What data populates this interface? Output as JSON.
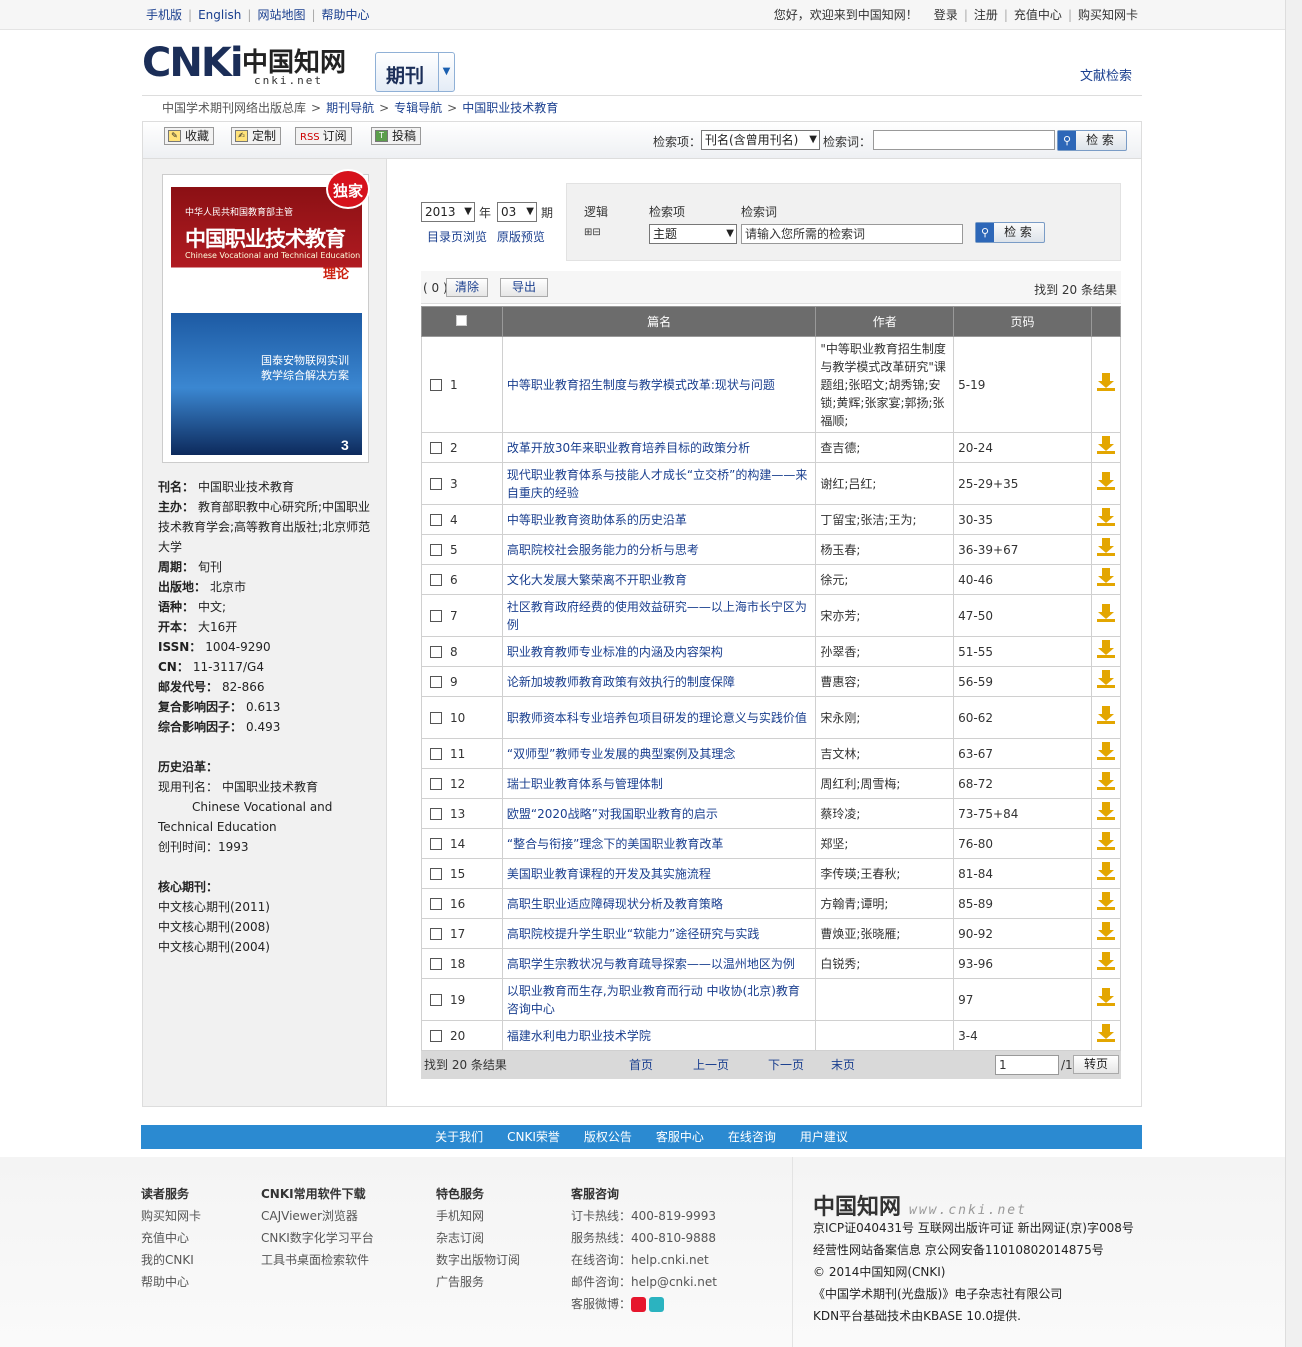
{
  "topbar": {
    "left": [
      "手机版",
      "English",
      "网站地图",
      "帮助中心"
    ],
    "welcome": "您好，欢迎来到中国知网！",
    "right": [
      "登录",
      "注册",
      "充值中心",
      "购买知网卡"
    ]
  },
  "header": {
    "logo_text": "CNKi",
    "logo_cn": "中国知网",
    "logo_domain": "cnki.net",
    "journal_btn": "期刊",
    "wenxian": "文献检索"
  },
  "breadcrumb": [
    "中国学术期刊网络出版总库",
    "期刊导航",
    "专辑导航",
    "中国职业技术教育"
  ],
  "toolbar": {
    "buttons": [
      "收藏",
      "定制",
      "订阅",
      "投稿"
    ],
    "rss": "RSS",
    "search_item_label": "检索项：",
    "search_item_value": "刊名(含曾用刊名)",
    "search_word_label": "检索词：",
    "search_btn": "检 索"
  },
  "cover": {
    "line1": "中华人民共和国教育部主管",
    "title": "中国职业技术教育",
    "subtitle": "Chinese Vocational and Technical Education",
    "section": "理论",
    "badge": "独家",
    "brand": "国泰安物联网实训",
    "brand2": "教学综合解决方案",
    "issue": "3"
  },
  "journal_info": [
    {
      "k": "刊名：",
      "v": "中国职业技术教育"
    },
    {
      "k": "主办：",
      "v": "教育部职教中心研究所;中国职业技术教育学会;高等教育出版社;北京师范大学"
    },
    {
      "k": "周期：",
      "v": "旬刊"
    },
    {
      "k": "出版地：",
      "v": "北京市"
    },
    {
      "k": "语种：",
      "v": "中文;"
    },
    {
      "k": "开本：",
      "v": "大16开"
    },
    {
      "k": "ISSN：",
      "v": "1004-9290"
    },
    {
      "k": "CN：",
      "v": "11-3117/G4"
    },
    {
      "k": "邮发代号：",
      "v": "82-866"
    },
    {
      "k": "复合影响因子：",
      "v": "0.613"
    },
    {
      "k": "综合影响因子：",
      "v": "0.493"
    }
  ],
  "history": {
    "title": "历史沿革：",
    "current_label": "现用刊名：",
    "current": "中国职业技术教育",
    "english": "Chinese Vocational and Technical Education",
    "founded_label": "创刊时间：",
    "founded": "1993"
  },
  "core": {
    "title": "核心期刊：",
    "items": [
      "中文核心期刊(2011)",
      "中文核心期刊(2008)",
      "中文核心期刊(2004)"
    ]
  },
  "issue": {
    "year": "2013",
    "year_unit": "年",
    "no": "03",
    "no_unit": "期",
    "toc": "目录页浏览",
    "preview": "原版预览"
  },
  "adv": {
    "logic": "逻辑",
    "field": "检索项",
    "word": "检索词",
    "field_value": "主题",
    "placeholder": "请输入您所需的检索词",
    "search_btn": "检 索"
  },
  "results": {
    "selected": "( 0 )",
    "clear": "清除",
    "export": "导出",
    "found": "找到 20 条结果"
  },
  "table": {
    "headers": [
      "篇名",
      "作者",
      "页码"
    ],
    "rows": [
      {
        "n": "1",
        "title": "中等职业教育招生制度与教学模式改革:现状与问题",
        "author": "\"中等职业教育招生制度与教学模式改革研究\"课题组;张昭文;胡秀锦;安锁;黄辉;张家宴;郭扬;张福顺;",
        "pages": "5-19"
      },
      {
        "n": "2",
        "title": "改革开放30年来职业教育培养目标的政策分析",
        "author": "查吉德;",
        "pages": "20-24"
      },
      {
        "n": "3",
        "title": "现代职业教育体系与技能人才成长“立交桥”的构建——来自重庆的经验",
        "author": "谢红;吕红;",
        "pages": "25-29+35"
      },
      {
        "n": "4",
        "title": "中等职业教育资助体系的历史沿革",
        "author": "丁留宝;张洁;王为;",
        "pages": "30-35"
      },
      {
        "n": "5",
        "title": "高职院校社会服务能力的分析与思考",
        "author": "杨玉春;",
        "pages": "36-39+67"
      },
      {
        "n": "6",
        "title": "文化大发展大繁荣离不开职业教育",
        "author": "徐元;",
        "pages": "40-46"
      },
      {
        "n": "7",
        "title": "社区教育政府经费的使用效益研究——以上海市长宁区为例",
        "author": "宋亦芳;",
        "pages": "47-50"
      },
      {
        "n": "8",
        "title": "职业教育教师专业标准的内涵及内容架构",
        "author": "孙翠香;",
        "pages": "51-55"
      },
      {
        "n": "9",
        "title": "论新加坡教师教育政策有效执行的制度保障",
        "author": "曹惠容;",
        "pages": "56-59"
      },
      {
        "n": "10",
        "title": "职教师资本科专业培养包项目研发的理论意义与实践价值",
        "author": "宋永刚;",
        "pages": "60-62"
      },
      {
        "n": "11",
        "title": "“双师型”教师专业发展的典型案例及其理念",
        "author": "吉文林;",
        "pages": "63-67"
      },
      {
        "n": "12",
        "title": "瑞士职业教育体系与管理体制",
        "author": "周红利;周雪梅;",
        "pages": "68-72"
      },
      {
        "n": "13",
        "title": "欧盟“2020战略”对我国职业教育的启示",
        "author": "蔡玲凌;",
        "pages": "73-75+84"
      },
      {
        "n": "14",
        "title": "“整合与衔接”理念下的美国职业教育改革",
        "author": "郑坚;",
        "pages": "76-80"
      },
      {
        "n": "15",
        "title": "美国职业教育课程的开发及其实施流程",
        "author": "李传瑛;王春秋;",
        "pages": "81-84"
      },
      {
        "n": "16",
        "title": "高职生职业适应障碍现状分析及教育策略",
        "author": "方翰青;谭明;",
        "pages": "85-89"
      },
      {
        "n": "17",
        "title": "高职院校提升学生职业“软能力”途径研究与实践",
        "author": "曹焕亚;张晓雁;",
        "pages": "90-92"
      },
      {
        "n": "18",
        "title": "高职学生宗教状况与教育疏导探索——以温州地区为例",
        "author": "白锐秀;",
        "pages": "93-96"
      },
      {
        "n": "19",
        "title": "以职业教育而生存,为职业教育而行动 中收协(北京)教育咨询中心",
        "author": "",
        "pages": "97"
      },
      {
        "n": "20",
        "title": "福建水利电力职业技术学院",
        "author": "",
        "pages": "3-4"
      }
    ]
  },
  "pager": {
    "found": "找到 20 条结果",
    "first": "首页",
    "prev": "上一页",
    "next": "下一页",
    "last": "末页",
    "page": "1",
    "total": "/1",
    "go": "转页"
  },
  "bluebar": [
    "关于我们",
    "CNKI荣誉",
    "版权公告",
    "客服中心",
    "在线咨询",
    "用户建议"
  ],
  "footer": {
    "cols": [
      {
        "h": "读者服务",
        "items": [
          "购买知网卡",
          "充值中心",
          "我的CNKI",
          "帮助中心"
        ]
      },
      {
        "h": "CNKI常用软件下载",
        "items": [
          "CAJViewer浏览器",
          "CNKI数字化学习平台",
          "工具书桌面检索软件"
        ]
      },
      {
        "h": "特色服务",
        "items": [
          "手机知网",
          "杂志订阅",
          "数字出版物订阅",
          "广告服务"
        ]
      },
      {
        "h": "客服咨询",
        "items": [
          "订卡热线：400-819-9993",
          "服务热线：400-810-9888",
          "在线咨询：help.cnki.net",
          "邮件咨询：help@cnki.net",
          "客服微博："
        ]
      }
    ],
    "logo": "中国知网",
    "domain": "www.cnki.net",
    "lines": [
      "京ICP证040431号  互联网出版许可证  新出网证(京)字008号",
      "经营性网站备案信息  京公网安备11010802014875号",
      "© 2014中国知网(CNKI)",
      "《中国学术期刊(光盘版)》电子杂志社有限公司",
      "KDN平台基础技术由KBASE 10.0提供."
    ]
  },
  "colors": {
    "accent": "#2b8ad1",
    "header_gray": "#6c6c6c",
    "download": "#e3a600"
  }
}
